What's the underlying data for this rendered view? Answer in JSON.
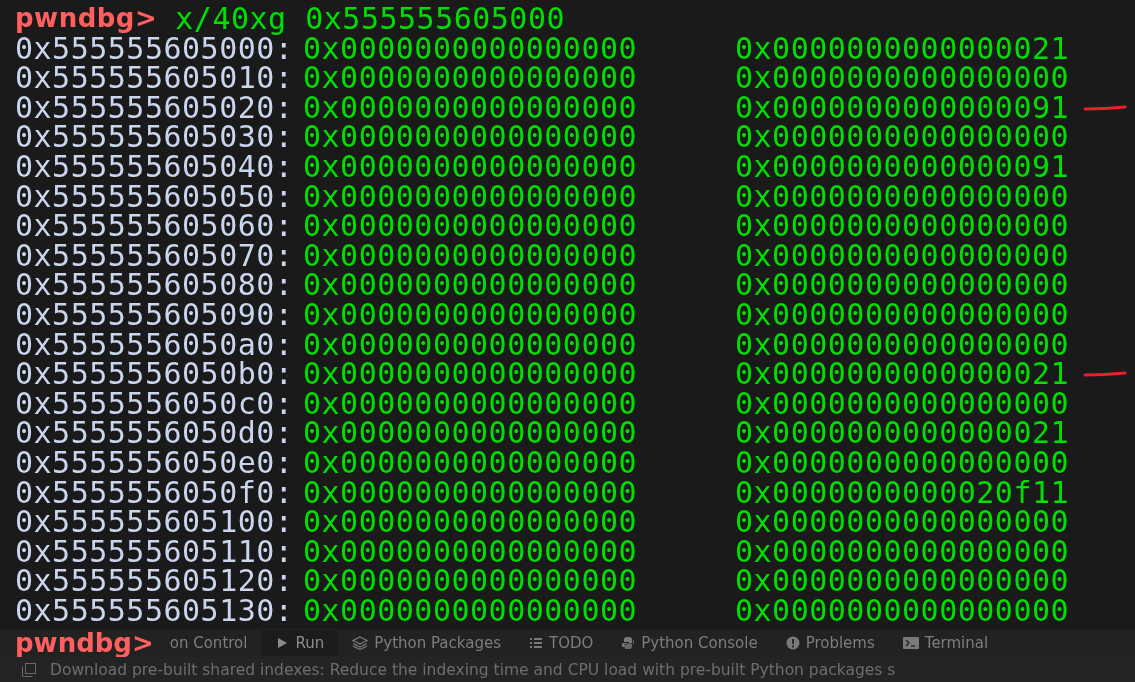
{
  "prompt": {
    "label": "pwndbg>",
    "command": "x/40xg 0x555555605000"
  },
  "rows": [
    {
      "address": "0x555555605000:",
      "value_1": "0x0000000000000000",
      "value_2": "0x0000000000000021",
      "marked": false
    },
    {
      "address": "0x555555605010:",
      "value_1": "0x0000000000000000",
      "value_2": "0x0000000000000000",
      "marked": false
    },
    {
      "address": "0x555555605020:",
      "value_1": "0x0000000000000000",
      "value_2": "0x0000000000000091",
      "marked": true
    },
    {
      "address": "0x555555605030:",
      "value_1": "0x0000000000000000",
      "value_2": "0x0000000000000000",
      "marked": false
    },
    {
      "address": "0x555555605040:",
      "value_1": "0x0000000000000000",
      "value_2": "0x0000000000000091",
      "marked": false
    },
    {
      "address": "0x555555605050:",
      "value_1": "0x0000000000000000",
      "value_2": "0x0000000000000000",
      "marked": false
    },
    {
      "address": "0x555555605060:",
      "value_1": "0x0000000000000000",
      "value_2": "0x0000000000000000",
      "marked": false
    },
    {
      "address": "0x555555605070:",
      "value_1": "0x0000000000000000",
      "value_2": "0x0000000000000000",
      "marked": false
    },
    {
      "address": "0x555555605080:",
      "value_1": "0x0000000000000000",
      "value_2": "0x0000000000000000",
      "marked": false
    },
    {
      "address": "0x555555605090:",
      "value_1": "0x0000000000000000",
      "value_2": "0x0000000000000000",
      "marked": false
    },
    {
      "address": "0x5555556050a0:",
      "value_1": "0x0000000000000000",
      "value_2": "0x0000000000000000",
      "marked": false
    },
    {
      "address": "0x5555556050b0:",
      "value_1": "0x0000000000000000",
      "value_2": "0x0000000000000021",
      "marked": true
    },
    {
      "address": "0x5555556050c0:",
      "value_1": "0x0000000000000000",
      "value_2": "0x0000000000000000",
      "marked": false
    },
    {
      "address": "0x5555556050d0:",
      "value_1": "0x0000000000000000",
      "value_2": "0x0000000000000021",
      "marked": false
    },
    {
      "address": "0x5555556050e0:",
      "value_1": "0x0000000000000000",
      "value_2": "0x0000000000000000",
      "marked": false
    },
    {
      "address": "0x5555556050f0:",
      "value_1": "0x0000000000000000",
      "value_2": "0x0000000000020f11",
      "marked": false
    },
    {
      "address": "0x555555605100:",
      "value_1": "0x0000000000000000",
      "value_2": "0x0000000000000000",
      "marked": false
    },
    {
      "address": "0x555555605110:",
      "value_1": "0x0000000000000000",
      "value_2": "0x0000000000000000",
      "marked": false
    },
    {
      "address": "0x555555605120:",
      "value_1": "0x0000000000000000",
      "value_2": "0x0000000000000000",
      "marked": false
    },
    {
      "address": "0x555555605130:",
      "value_1": "0x0000000000000000",
      "value_2": "0x0000000000000000",
      "marked": false
    }
  ],
  "end_prompt": "pwndbg>",
  "tool_tabs": [
    {
      "label": "on Control",
      "kind": "plain",
      "selected": false
    },
    {
      "label": "Run",
      "kind": "run",
      "selected": true
    },
    {
      "label": "Python Packages",
      "kind": "packages",
      "selected": false
    },
    {
      "label": "TODO",
      "kind": "list",
      "selected": false
    },
    {
      "label": "Python Console",
      "kind": "python",
      "selected": false
    },
    {
      "label": "Problems",
      "kind": "problems",
      "selected": false
    },
    {
      "label": "Terminal",
      "kind": "terminal",
      "selected": false
    }
  ],
  "status_bar": "Download pre-built shared indexes: Reduce the indexing time and CPU load with pre-built Python packages s"
}
